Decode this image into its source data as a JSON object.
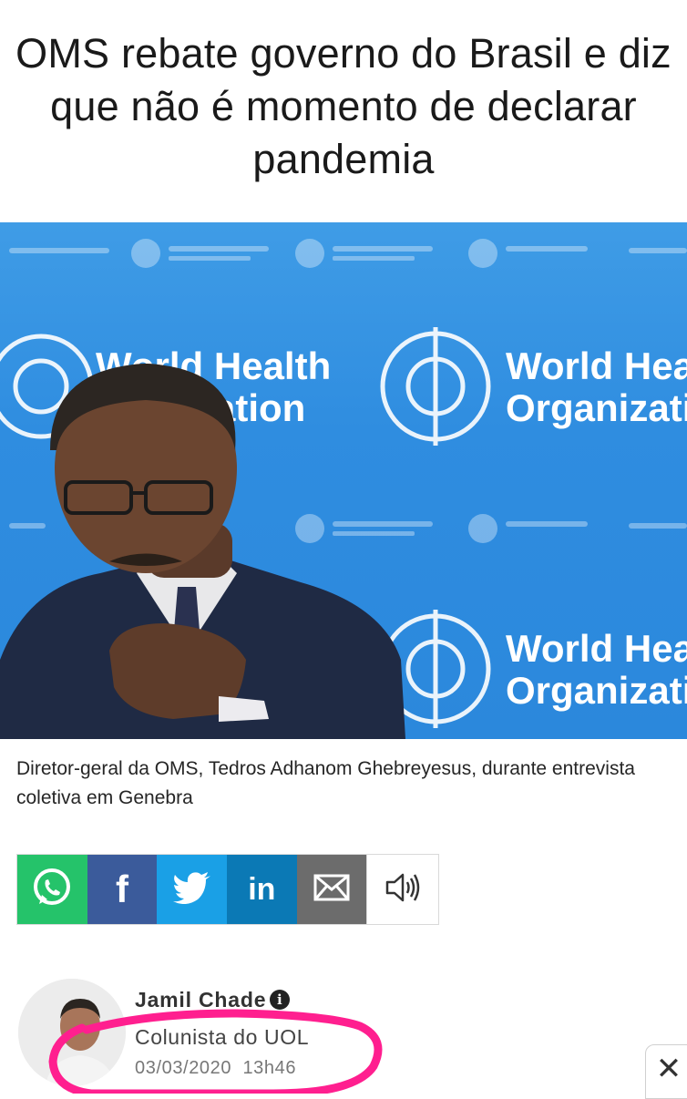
{
  "article": {
    "headline": "OMS rebate governo do Brasil e diz que não é momento de declarar pandemia",
    "photo": {
      "background_text_left_1": "World Health",
      "background_text_left_2": "ation",
      "background_text_right_1": "World Hea",
      "background_text_right_2": "Organizati",
      "background_text_right_3": "World Hea",
      "background_text_right_4": "Organizati"
    },
    "caption": "Diretor-geral da OMS, Tedros Adhanom Ghebreyesus, durante entrevista coletiva em Genebra"
  },
  "share": {
    "buttons": [
      {
        "name": "whatsapp",
        "icon": "whatsapp-icon",
        "color": "#25c36a"
      },
      {
        "name": "facebook",
        "icon": "facebook-icon",
        "label": "f",
        "color": "#3b5b9b"
      },
      {
        "name": "twitter",
        "icon": "twitter-icon",
        "color": "#1aa0e6"
      },
      {
        "name": "linkedin",
        "icon": "linkedin-icon",
        "label": "in",
        "color": "#0b79b5"
      },
      {
        "name": "email",
        "icon": "envelope-icon",
        "color": "#6c6c6c"
      },
      {
        "name": "audio",
        "icon": "speaker-icon",
        "color": "#ffffff"
      }
    ],
    "facebook_label": "f",
    "linkedin_label": "in"
  },
  "author": {
    "name": "Jamil Chade",
    "info_icon": "i",
    "role": "Colunista do UOL",
    "date": "03/03/2020",
    "time": "13h46"
  },
  "ui": {
    "close_label": "✕",
    "highlight_color": "#ff1f8f"
  }
}
